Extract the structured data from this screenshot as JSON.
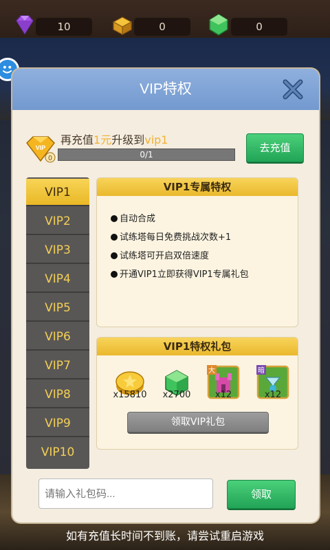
{
  "top_bar": {
    "currencies": [
      {
        "icon": "purple-gem-icon",
        "value": "10"
      },
      {
        "icon": "gold-chest-icon",
        "value": "0"
      },
      {
        "icon": "green-gem-icon",
        "value": "0"
      }
    ]
  },
  "dialog": {
    "title": "VIP特权",
    "vip_badge_level": "0",
    "upgrade": {
      "prefix": "再充值",
      "amount": "1元",
      "middle": "升级到",
      "target": "vip1"
    },
    "progress": {
      "text": "0/1",
      "fraction": 0.0
    },
    "recharge_button": "去充值",
    "tabs": [
      "VIP1",
      "VIP2",
      "VIP3",
      "VIP4",
      "VIP5",
      "VIP6",
      "VIP7",
      "VIP8",
      "VIP9",
      "VIP10"
    ],
    "active_tab": "VIP1",
    "privileges": {
      "title": "VIP1专属特权",
      "items": [
        "自动合成",
        "试练塔每日免费挑战次数+1",
        "试练塔可开启双倍速度",
        "开通VIP1立即获得VIP1专属礼包"
      ]
    },
    "gift_pack": {
      "title": "VIP1特权礼包",
      "items": [
        {
          "icon": "gold-coin-icon",
          "count": "x15810"
        },
        {
          "icon": "green-gem-icon",
          "count": "x2700"
        },
        {
          "icon": "big-castle-card-icon",
          "badge": "大",
          "count": "x12"
        },
        {
          "icon": "dark-fountain-card-icon",
          "badge": "暗",
          "count": "x12"
        }
      ],
      "claim_button": "领取VIP礼包"
    },
    "code_input": {
      "placeholder": "请输入礼包码...",
      "value": ""
    },
    "claim_code_button": "领取"
  },
  "footer_note": "如有充值长时间不到账，请尝试重启游戏",
  "colors": {
    "header_blue": "#7f9fd6",
    "tab_active": "#f2c73c",
    "tab_text": "#f4cf55",
    "highlight": "#f2b232",
    "button_green": "#2fb865"
  }
}
